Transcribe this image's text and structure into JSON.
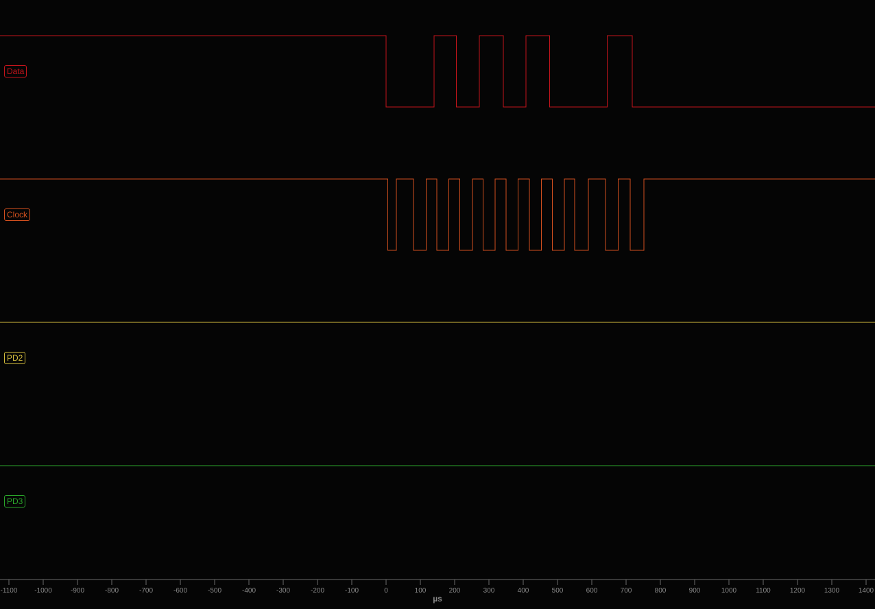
{
  "channels": [
    {
      "name": "Data",
      "color": "#c4141b",
      "transitions": [
        0,
        140,
        205,
        272,
        342,
        408,
        477,
        645,
        718
      ],
      "initial": "high"
    },
    {
      "name": "Clock",
      "color": "#d2501e",
      "transitions": [
        5,
        30,
        80,
        117,
        148,
        183,
        215,
        252,
        283,
        318,
        350,
        385,
        418,
        453,
        485,
        520,
        550,
        590,
        640,
        677,
        712,
        752
      ],
      "initial": "high"
    },
    {
      "name": "PD2",
      "color": "#d3bc3d",
      "transitions": [],
      "initial": "high"
    },
    {
      "name": "PD3",
      "color": "#2aa52a",
      "transitions": [],
      "initial": "high"
    }
  ],
  "time_axis": {
    "unit": "µs",
    "range": [
      -1126,
      1426
    ],
    "ticks": [
      -1100,
      -1000,
      -900,
      -800,
      -700,
      -600,
      -500,
      -400,
      -300,
      -200,
      -100,
      0,
      100,
      200,
      300,
      400,
      500,
      600,
      700,
      800,
      900,
      1000,
      1100,
      1200,
      1300,
      1400
    ],
    "line_color": "#6a6a6a",
    "text_color": "#8a8a8a"
  }
}
